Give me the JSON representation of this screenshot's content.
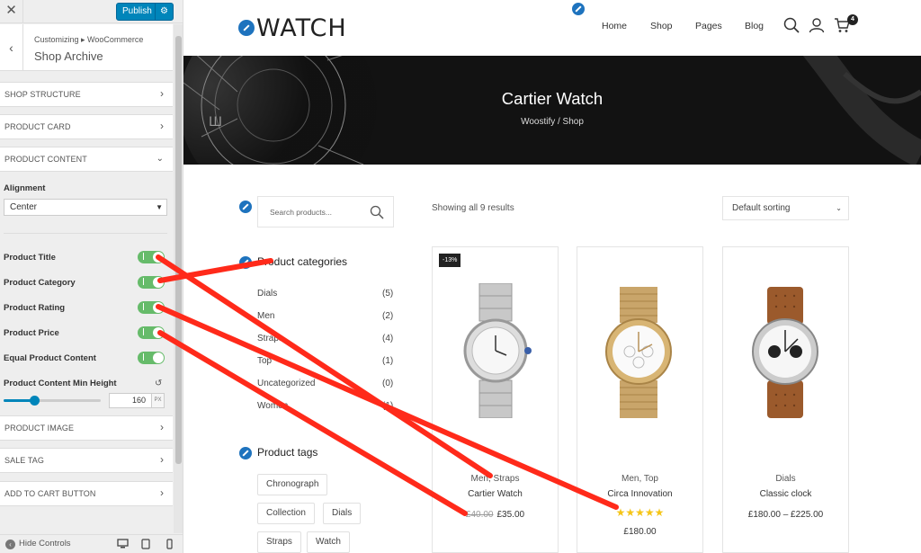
{
  "sidebar": {
    "publish_label": "Publish",
    "breadcrumb": "Customizing ▸ WooCommerce",
    "title": "Shop Archive",
    "sections_top": [
      "Shop Structure",
      "Product Card",
      "Product Content"
    ],
    "alignment_label": "Alignment",
    "alignment_value": "Center",
    "toggles": [
      {
        "label": "Product Title",
        "on": true
      },
      {
        "label": "Product Category",
        "on": true
      },
      {
        "label": "Product Rating",
        "on": true
      },
      {
        "label": "Product Price",
        "on": true
      },
      {
        "label": "Equal Product Content",
        "on": true
      }
    ],
    "min_height_label": "Product Content Min Height",
    "min_height_value": "160",
    "min_height_unit": "PX",
    "sections_bottom": [
      "Product Image",
      "Sale Tag",
      "Add To Cart Button"
    ],
    "hide_controls": "Hide Controls"
  },
  "site": {
    "logo": "WATCH",
    "nav": [
      "Home",
      "Shop",
      "Pages",
      "Blog"
    ],
    "cart_count": "4",
    "hero_title": "Cartier Watch",
    "hero_crumb": "Woostify / Shop",
    "search_placeholder": "Search products...",
    "categories_title": "Product categories",
    "categories": [
      {
        "name": "Dials",
        "count": "(5)"
      },
      {
        "name": "Men",
        "count": "(2)"
      },
      {
        "name": "Straps",
        "count": "(4)"
      },
      {
        "name": "Top",
        "count": "(1)"
      },
      {
        "name": "Uncategorized",
        "count": "(0)"
      },
      {
        "name": "Women",
        "count": "(1)"
      }
    ],
    "tags_title": "Product tags",
    "tags": [
      "Chronograph",
      "Collection",
      "Dials",
      "Straps",
      "Watch"
    ],
    "results": "Showing all 9 results",
    "sorting": "Default sorting"
  },
  "products": [
    {
      "sale": "-13%",
      "category": "Men, Straps",
      "name": "Cartier Watch",
      "old_price": "£40.00",
      "price": "£35.00",
      "rating": ""
    },
    {
      "sale": "",
      "category": "Men, Top",
      "name": "Circa Innovation",
      "old_price": "",
      "price": "£180.00",
      "rating": "★★★★★"
    },
    {
      "sale": "",
      "category": "Dials",
      "name": "Classic clock",
      "old_price": "",
      "price": "£180.00 – £225.00",
      "rating": ""
    }
  ],
  "colors": {
    "accent": "#0085ba",
    "toggle_on": "#66bb6a",
    "annotation": "#ff2a1a",
    "edit_dot": "#1e73be"
  }
}
